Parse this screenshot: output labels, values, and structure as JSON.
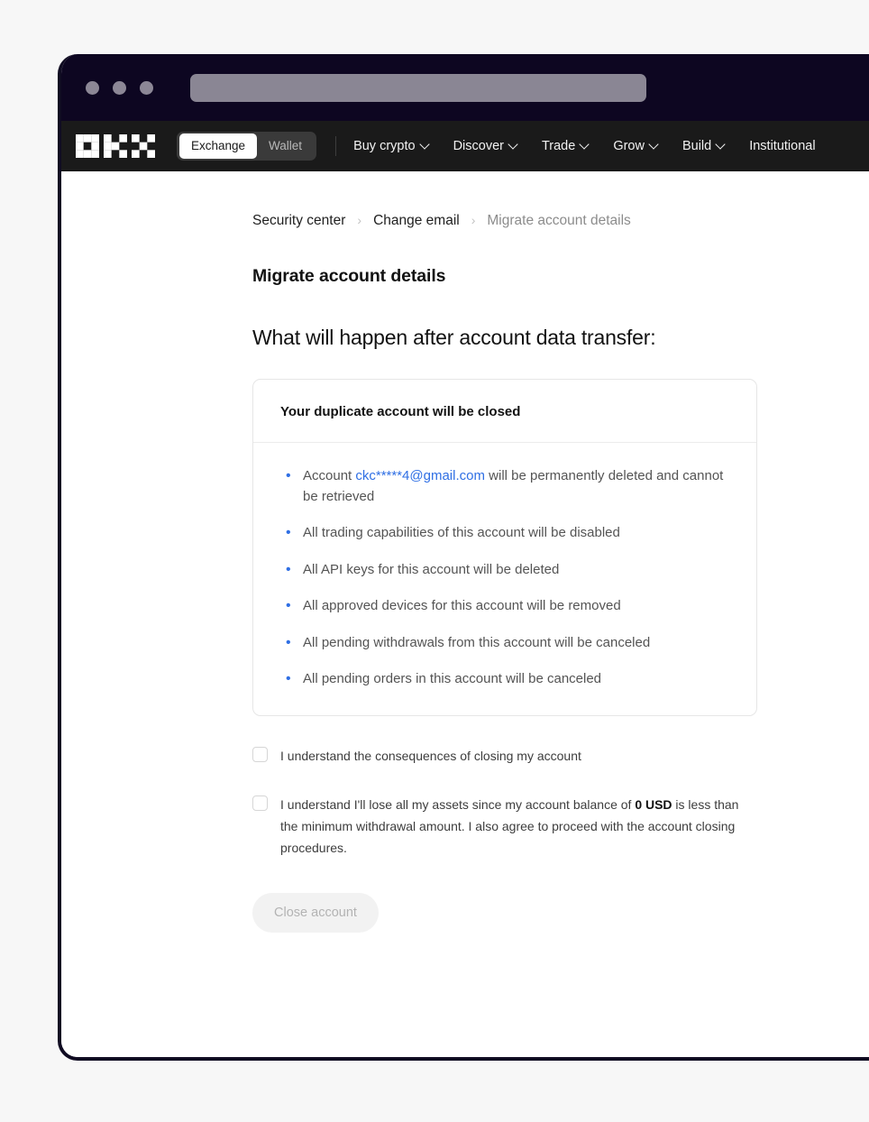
{
  "browser": {
    "traffic_lights": [
      "close-dot",
      "minimize-dot",
      "maximize-dot"
    ],
    "address_bar_value": "",
    "address_bar_placeholder": ""
  },
  "navbar": {
    "logo": "okx-logo",
    "product_switch": {
      "active": "Exchange",
      "options": [
        "Exchange",
        "Wallet"
      ]
    },
    "links": [
      {
        "label": "Buy crypto",
        "has_dropdown": true
      },
      {
        "label": "Discover",
        "has_dropdown": true
      },
      {
        "label": "Trade",
        "has_dropdown": true
      },
      {
        "label": "Grow",
        "has_dropdown": true
      },
      {
        "label": "Build",
        "has_dropdown": true
      },
      {
        "label": "Institutional",
        "has_dropdown": false
      }
    ]
  },
  "breadcrumb": {
    "separator": "›",
    "items": [
      {
        "label": "Security center",
        "current": false
      },
      {
        "label": "Change email",
        "current": false
      },
      {
        "label": "Migrate account details",
        "current": true
      }
    ]
  },
  "page": {
    "title": "Migrate account details",
    "section_heading": "What will happen after account data transfer:"
  },
  "card": {
    "header": "Your duplicate account will be closed",
    "items": [
      {
        "prefix": "Account ",
        "highlight": "ckc*****4@gmail.com",
        "suffix": " will be permanently deleted and cannot be retrieved"
      },
      {
        "text": "All trading capabilities of this account will be disabled"
      },
      {
        "text": "All API keys for this account will be deleted"
      },
      {
        "text": "All approved devices for this account will be removed"
      },
      {
        "text": "All pending withdrawals from this account will be canceled"
      },
      {
        "text": "All pending orders in this account will be canceled"
      }
    ]
  },
  "consents": {
    "first": {
      "label": "I understand the consequences of closing my account",
      "checked": false
    },
    "second": {
      "part1": "I understand I'll lose all my assets since my account balance of ",
      "amount": "0 USD",
      "part2": " is less than the minimum withdrawal amount. I also agree to proceed with the account closing procedures.",
      "checked": false
    }
  },
  "actions": {
    "close_account_label": "Close account",
    "close_account_disabled": true
  },
  "colors": {
    "accent_blue": "#2f6fe4",
    "chrome_bg": "#0d0621",
    "navbar_bg": "#1a1a1a",
    "page_bg": "#ffffff",
    "canvas_bg": "#f7f7f7",
    "muted_text": "#545454",
    "disabled_button_bg": "#f2f2f2"
  }
}
